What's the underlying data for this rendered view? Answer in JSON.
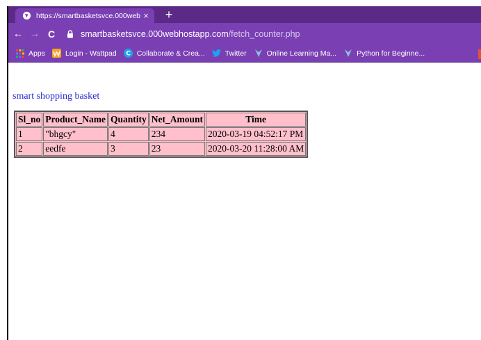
{
  "browser": {
    "tab": {
      "title": "https://smartbasketsvce.000webl",
      "close": "×"
    },
    "new_tab": "+",
    "nav": {
      "back": "←",
      "forward": "→",
      "reload": "C"
    },
    "address": {
      "host": "smartbasketsvce.000webhostapp.com",
      "path": "/fetch_counter.php"
    },
    "bookmarks": [
      {
        "label": "Apps",
        "icon": "apps-grid-icon"
      },
      {
        "label": "Login - Wattpad",
        "icon": "wattpad-icon"
      },
      {
        "label": "Collaborate & Crea...",
        "icon": "collaborate-icon"
      },
      {
        "label": "Twitter",
        "icon": "twitter-icon"
      },
      {
        "label": "Online Learning Ma...",
        "icon": "learning-icon"
      },
      {
        "label": "Python for Beginne...",
        "icon": "python-icon"
      }
    ],
    "colors": {
      "tab_strip": "#5a2a86",
      "toolbar": "#7a3fb3"
    }
  },
  "page": {
    "heading": "smart shopping basket",
    "table": {
      "headers": [
        "Sl_no",
        "Product_Name",
        "Quantity",
        "Net_Amount",
        "Time"
      ],
      "rows": [
        [
          "1",
          "\"bhgcy\"",
          "4",
          "234",
          "2020-03-19 04:52:17 PM"
        ],
        [
          "2",
          "eedfe",
          "3",
          "23",
          "2020-03-20 11:28:00 AM"
        ]
      ]
    },
    "colors": {
      "heading": "#2a2ad6",
      "table_bg": "#ffc0cb"
    }
  }
}
